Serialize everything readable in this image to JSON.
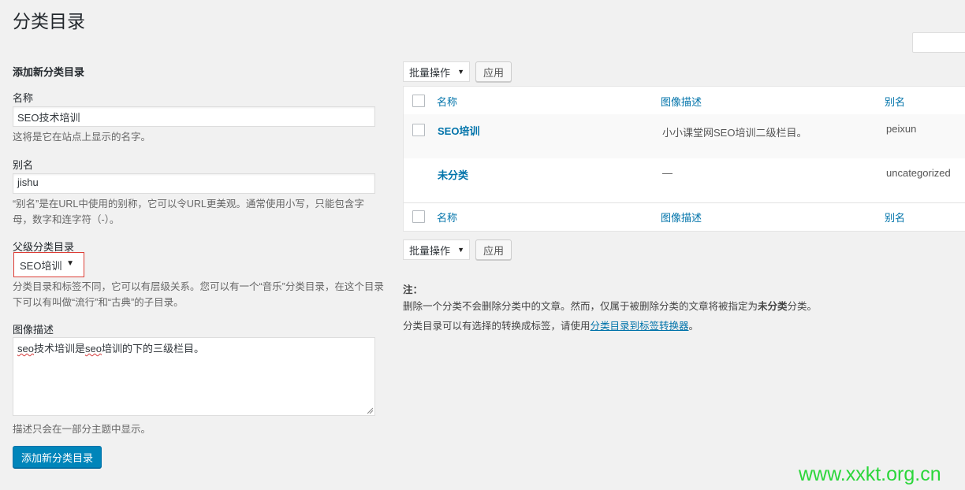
{
  "page": {
    "title": "分类目录"
  },
  "form": {
    "section_title": "添加新分类目录",
    "name_label": "名称",
    "name_value": "SEO技术培训",
    "name_hint": "这将是它在站点上显示的名字。",
    "slug_label": "别名",
    "slug_value": "jishu",
    "slug_hint": "“别名”是在URL中使用的别称，它可以令URL更美观。通常使用小写，只能包含字母，数字和连字符（-）。",
    "parent_label": "父级分类目录",
    "parent_value": "SEO培训",
    "parent_hint": "分类目录和标签不同，它可以有层级关系。您可以有一个“音乐”分类目录，在这个目录下可以有叫做“流行”和“古典”的子目录。",
    "desc_label": "图像描述",
    "desc_value_word1": "seo",
    "desc_value_mid": "技术培训是",
    "desc_value_word2": "seo",
    "desc_value_end": "培训的下的三级栏目。",
    "desc_hint": "描述只会在一部分主题中显示。",
    "submit_label": "添加新分类目录"
  },
  "list": {
    "bulk_label": "批量操作",
    "apply_label": "应用",
    "columns": {
      "name": "名称",
      "description": "图像描述",
      "slug": "别名"
    },
    "rows": [
      {
        "name": "SEO培训",
        "description": "小小课堂网SEO培训二级栏目。",
        "slug": "peixun"
      },
      {
        "name": "未分类",
        "description": "—",
        "slug": "uncategorized"
      }
    ]
  },
  "notes": {
    "title": "注：",
    "line1_pre": "删除一个分类不会删除分类中的文章。然而，仅属于被删除分类的文章将被指定为",
    "line1_bold": "未分类",
    "line1_post": "分类。",
    "line2_pre": "分类目录可以有选择的转换成标签，请使用",
    "line2_link": "分类目录到标签转换器",
    "line2_post": "。"
  },
  "watermark": "www.xxkt.org.cn",
  "colors": {
    "accent": "#0073aa",
    "primary_button": "#0085ba",
    "highlight_border": "#dd3d36",
    "watermark": "#2bd63a"
  }
}
